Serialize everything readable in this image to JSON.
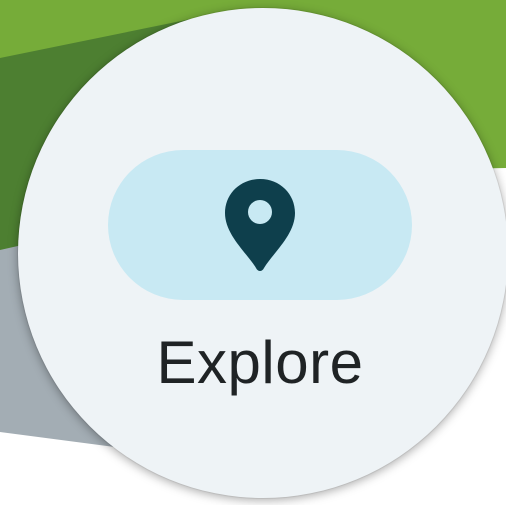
{
  "nav": {
    "active_item": {
      "label": "Explore",
      "icon": "map-pin-icon",
      "selected": true
    }
  },
  "colors": {
    "background_green": "#76ac39",
    "background_dark_green": "#4d7f31",
    "background_gray": "#a3adb4",
    "surface": "#eef3f6",
    "active_indicator": "#c8e9f3",
    "icon": "#0e3f4c",
    "label": "#1f2325"
  }
}
